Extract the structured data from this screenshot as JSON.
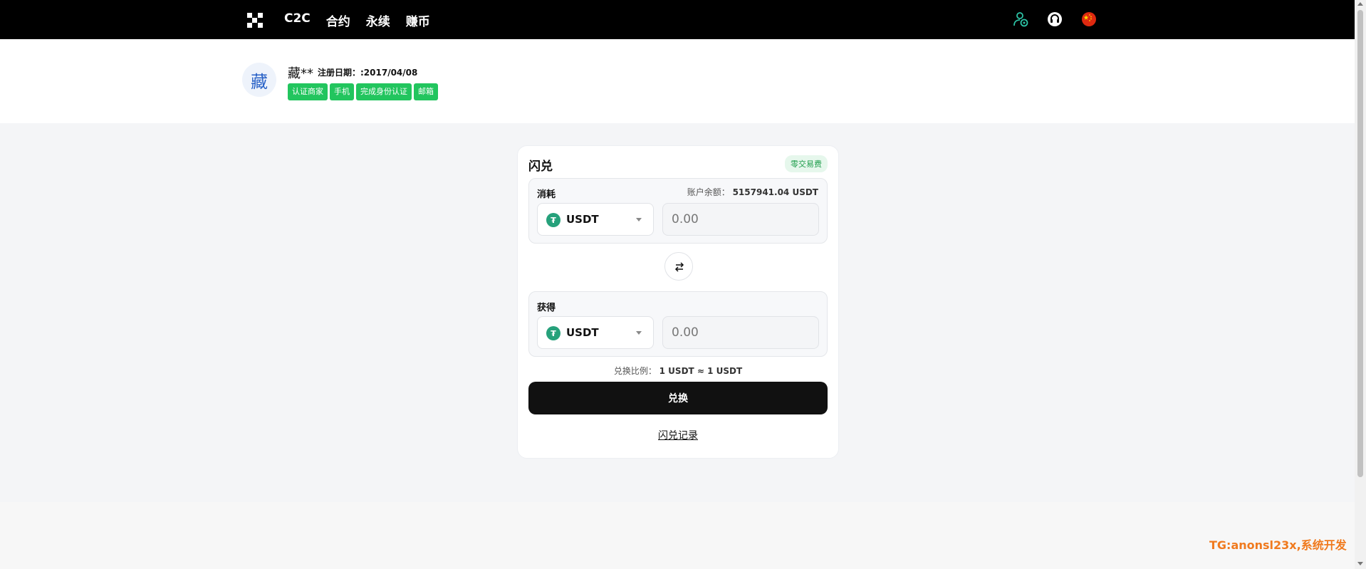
{
  "nav": {
    "items": [
      "C2C",
      "合约",
      "永续",
      "赚币"
    ]
  },
  "top_icons": [
    "user-account-icon",
    "headset-support-icon",
    "china-flag-icon"
  ],
  "profile": {
    "avatar_char": "藏",
    "username": "藏**",
    "reg_date": "注册日期：:2017/04/08",
    "badges": [
      "认证商家",
      "手机",
      "完成身份认证",
      "邮箱"
    ]
  },
  "swap": {
    "title": "闪兑",
    "fee_badge": "零交易费",
    "consume": {
      "label": "消耗",
      "balance_label": "账户余额：",
      "balance_value": "5157941.04 USDT",
      "coin": "USDT",
      "amount": "0.00"
    },
    "receive": {
      "label": "获得",
      "coin": "USDT",
      "amount": "0.00"
    },
    "rate_label": "兑换比例：",
    "rate_value": "1 USDT ≈ 1 USDT",
    "button": "兑换",
    "records_link": "闪兑记录"
  },
  "watermark": "TG:anonsl23x,系统开发",
  "colors": {
    "badge_green": "#22c55e",
    "usdt_teal": "#26a17b",
    "watermark_orange": "#f07a1e"
  }
}
